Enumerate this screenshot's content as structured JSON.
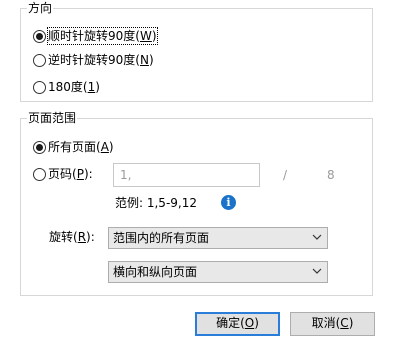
{
  "direction_group": {
    "title": "方向",
    "options": [
      {
        "text": "顺时针旋转90度(",
        "key": "W",
        "suffix": ")",
        "checked": true
      },
      {
        "text": "逆时针旋转90度(",
        "key": "N",
        "suffix": ")",
        "checked": false
      },
      {
        "text": "180度(",
        "key": "1",
        "suffix": ")",
        "checked": false
      }
    ]
  },
  "page_range_group": {
    "title": "页面范围",
    "all_pages": {
      "text": "所有页面(",
      "key": "A",
      "suffix": ")",
      "checked": true
    },
    "page_numbers": {
      "text": "页码(",
      "key": "P",
      "suffix": "):",
      "checked": false
    },
    "page_input_value": "1,",
    "separator": "/",
    "total_pages": "8",
    "example": "范例: 1,5-9,12",
    "info_icon": "info-icon",
    "rotate_label": {
      "text": "旋转(",
      "key": "R",
      "suffix": "):"
    },
    "rotate_select_value": "范围内的所有页面",
    "orientation_select_value": "横向和纵向页面"
  },
  "buttons": {
    "ok": {
      "text": "确定(",
      "key": "O",
      "suffix": ")"
    },
    "cancel": {
      "text": "取消(",
      "key": "C",
      "suffix": ")"
    }
  },
  "colors": {
    "accent": "#2a7dd8",
    "info": "#1a73c9",
    "border": "#d7d7d7"
  }
}
